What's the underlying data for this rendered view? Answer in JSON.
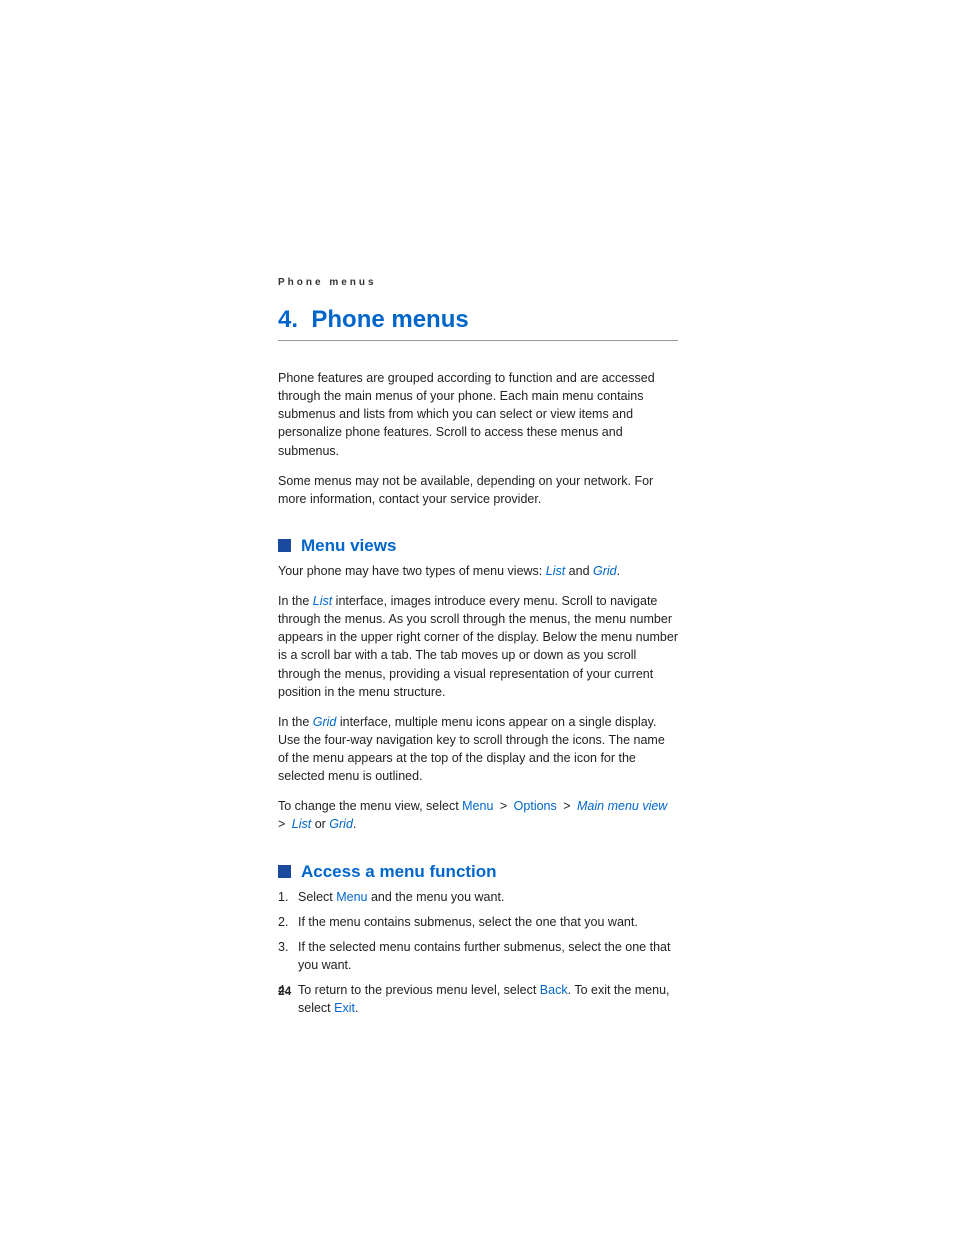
{
  "running_head": "Phone menus",
  "chapter": {
    "number": "4.",
    "title": "Phone menus"
  },
  "intro": {
    "p1": "Phone features are grouped according to function and are accessed through the main menus of your phone. Each main menu contains submenus and lists from which you can select or view items and personalize phone features. Scroll to access these menus and submenus.",
    "p2": "Some menus may not be available, depending on your network. For more information, contact your service provider."
  },
  "sections": {
    "menu_views": {
      "title": "Menu views",
      "p1_a": "Your phone may have two types of menu views: ",
      "p1_list": "List",
      "p1_and": " and ",
      "p1_grid": "Grid",
      "p1_end": ".",
      "p2_a": "In the ",
      "p2_list": "List",
      "p2_b": " interface, images introduce every menu. Scroll to navigate through the menus. As you scroll through the menus, the menu number appears in the upper right corner of the display. Below the menu number is a scroll bar with a tab. The tab moves up or down as you scroll through the menus, providing a visual representation of your current position in the menu structure.",
      "p3_a": "In the ",
      "p3_grid": "Grid",
      "p3_b": " interface, multiple menu icons appear on a single display. Use the four-way navigation key to scroll through the icons. The name of the menu appears at the top of the display and the icon for the selected menu is outlined.",
      "p4_a": "To change the menu view, select ",
      "p4_menu": "Menu",
      "p4_gt1": " > ",
      "p4_options": "Options",
      "p4_gt2": " > ",
      "p4_main": "Main menu view",
      "p4_gt3": " > ",
      "p4_list": "List",
      "p4_or": " or ",
      "p4_grid": "Grid",
      "p4_end": "."
    },
    "access": {
      "title": "Access a menu function",
      "li1_a": "Select ",
      "li1_menu": "Menu",
      "li1_b": " and the menu you want.",
      "li2": "If the menu contains submenus, select the one that you want.",
      "li3": "If the selected menu contains further submenus, select the one that you want.",
      "li4_a": "To return to the previous menu level, select ",
      "li4_back": "Back",
      "li4_b": ". To exit the menu, select ",
      "li4_exit": "Exit",
      "li4_c": "."
    }
  },
  "page_number": "24"
}
